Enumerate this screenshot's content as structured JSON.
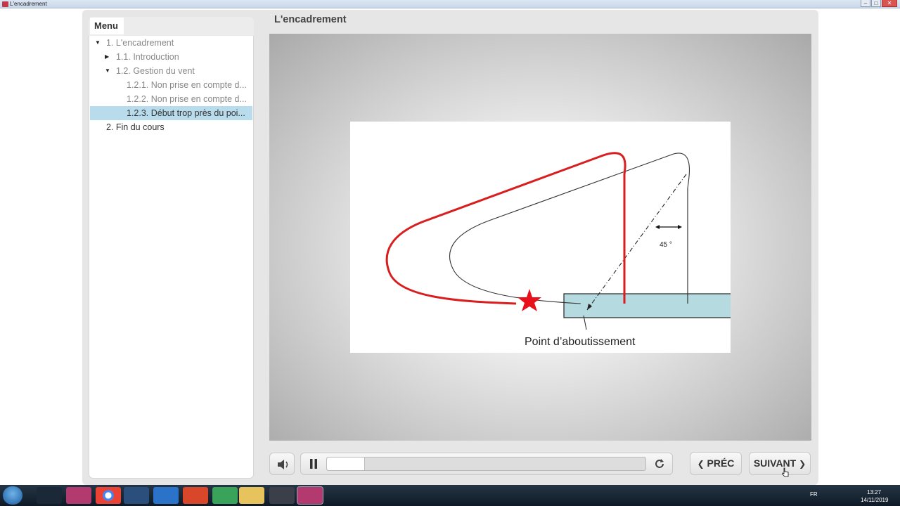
{
  "window": {
    "title": "L'encadrement",
    "minimize": "–",
    "maximize": "□",
    "close": "✕"
  },
  "menu": {
    "label": "Menu",
    "items": [
      {
        "label": "1. L'encadrement",
        "expanded": true
      },
      {
        "label": "1.1. Introduction",
        "expanded": false
      },
      {
        "label": "1.2. Gestion du vent",
        "expanded": true
      },
      {
        "label": "1.2.1. Non prise en compte d..."
      },
      {
        "label": "1.2.2. Non prise en compte d..."
      },
      {
        "label": "1.2.3. Début trop près du poi...",
        "selected": true
      },
      {
        "label": "2. Fin du cours"
      }
    ]
  },
  "lesson": {
    "title": "L'encadrement"
  },
  "slide": {
    "caption": "Point d’aboutissement",
    "angle_label": "45 °",
    "colors": {
      "red_path": "#d81e1e",
      "runway": "#b5dbe0",
      "star": "#e8111b"
    }
  },
  "player": {
    "progress": 0.12,
    "prev_label": "PRÉC",
    "next_label": "SUIVANT"
  },
  "taskbar": {
    "lang": "FR",
    "time": "13:27",
    "date": "14/11/2019"
  }
}
